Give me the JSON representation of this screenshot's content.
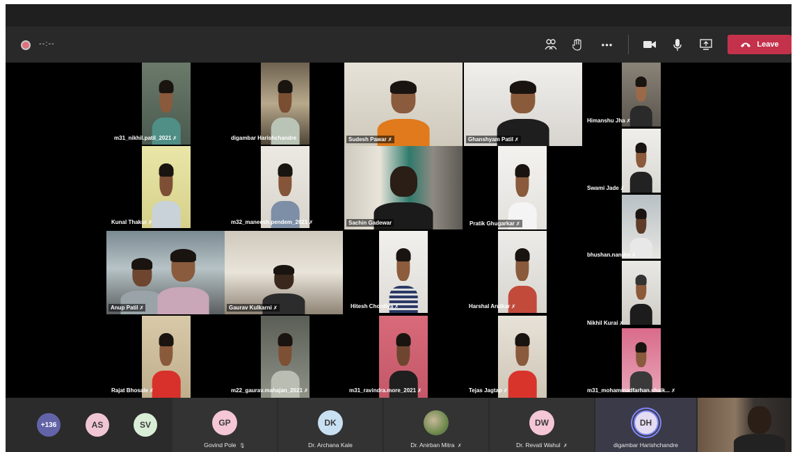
{
  "toolbar": {
    "timer": "--:--",
    "icons": [
      "participants-icon",
      "raise-hand-icon",
      "more-icon",
      "camera-icon",
      "mic-icon",
      "share-icon"
    ],
    "more_label": "•••",
    "leave_label": "Leave",
    "leave_color": "#c4314b"
  },
  "tiles": [
    {
      "name": "m31_nikhil.patil_2021",
      "muted": true
    },
    {
      "name": "digambar Harishchandre",
      "muted": false
    },
    {
      "name": "Sudesh Pawar",
      "muted": true
    },
    {
      "name": "Ghanshyam Patil",
      "muted": true
    },
    {
      "name": "Himanshu Jha",
      "muted": true
    },
    {
      "name": "Kunal Thakur",
      "muted": true
    },
    {
      "name": "m32_maneesh.pendem_2021",
      "muted": true
    },
    {
      "name": "Sachin Gadewar",
      "muted": false
    },
    {
      "name": "Pratik Ghugarkar",
      "muted": true
    },
    {
      "name": "Swami Jade",
      "muted": true
    },
    {
      "name": "Anup Patil",
      "muted": true
    },
    {
      "name": "Gaurav Kulkarni",
      "muted": true
    },
    {
      "name": "Hitesh Chordiya",
      "muted": true
    },
    {
      "name": "Harshal Arulkar",
      "muted": true
    },
    {
      "name": "bhushan.nandre",
      "muted": true
    },
    {
      "name": "Nikhil Kurai",
      "muted": true
    },
    {
      "name": "Rajat Bhosale",
      "muted": true
    },
    {
      "name": "m22_gaurav.mahajan_2021",
      "muted": true
    },
    {
      "name": "m31_ravindra.more_2021",
      "muted": true
    },
    {
      "name": "Tejas Jagtap",
      "muted": true
    },
    {
      "name": "m31_mohammadfarhan.shaik...",
      "muted": true
    }
  ],
  "tray": {
    "overflow_count": "+136",
    "avatars": [
      {
        "initials": "AS",
        "color": "#f1c6d4"
      },
      {
        "initials": "SV",
        "color": "#d9eed6"
      }
    ],
    "participants": [
      {
        "initials": "GP",
        "name": "Govind Pole",
        "color": "#f4c6d6"
      },
      {
        "initials": "DK",
        "name": "Dr. Archana Kale",
        "color": "#c9dff2"
      },
      {
        "initials": "",
        "name": "Dr. Anirban Mitra",
        "color": "#8aa06a"
      },
      {
        "initials": "DW",
        "name": "Dr. Revati Wahul",
        "color": "#f4c6d6"
      },
      {
        "initials": "DH",
        "name": "digambar Harishchandre",
        "color": "#e4dcf2"
      }
    ]
  }
}
